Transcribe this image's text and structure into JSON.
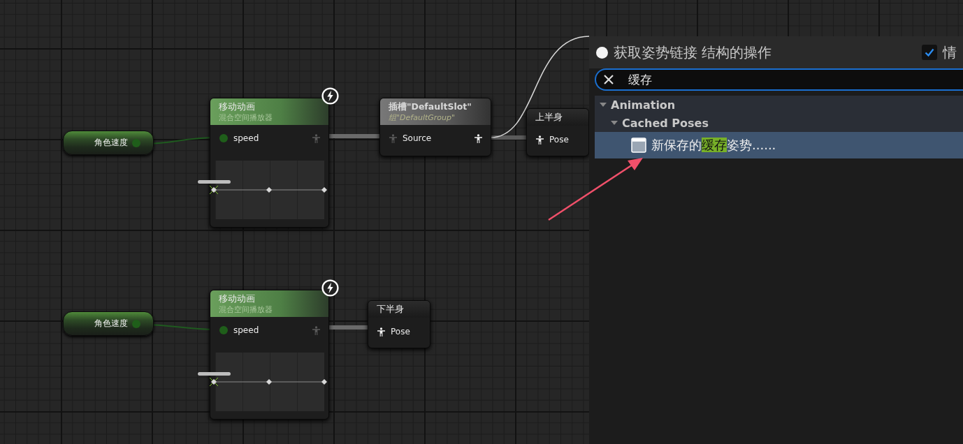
{
  "graph": {
    "nodes": [
      {
        "kind": "variable",
        "title": "角色速度"
      },
      {
        "kind": "blend_space",
        "title": "移动动画",
        "subtitle": "混合空间播放器",
        "pin": "speed"
      },
      {
        "kind": "slot",
        "title": "插槽\"DefaultSlot\"",
        "subtitle": "组\"DefaultGroup\"",
        "pin": "Source"
      },
      {
        "kind": "cache",
        "title": "上半身",
        "pin": "Pose"
      },
      {
        "kind": "variable",
        "title": "角色速度"
      },
      {
        "kind": "blend_space",
        "title": "移动动画",
        "subtitle": "混合空间播放器",
        "pin": "speed"
      },
      {
        "kind": "cache",
        "title": "下半身",
        "pin": "Pose"
      }
    ]
  },
  "action_menu": {
    "title": "获取姿势链接 结构的操作",
    "context_checkbox": {
      "label": "情",
      "checked": true
    },
    "search": {
      "value": "缓存"
    },
    "tree": [
      {
        "label": "Animation",
        "expanded": true,
        "children": [
          {
            "label": "Cached Poses",
            "expanded": true,
            "children": [
              {
                "before": "新保存的",
                "match": "缓存",
                "after": "姿势......",
                "selected": true
              }
            ]
          }
        ]
      }
    ]
  }
}
